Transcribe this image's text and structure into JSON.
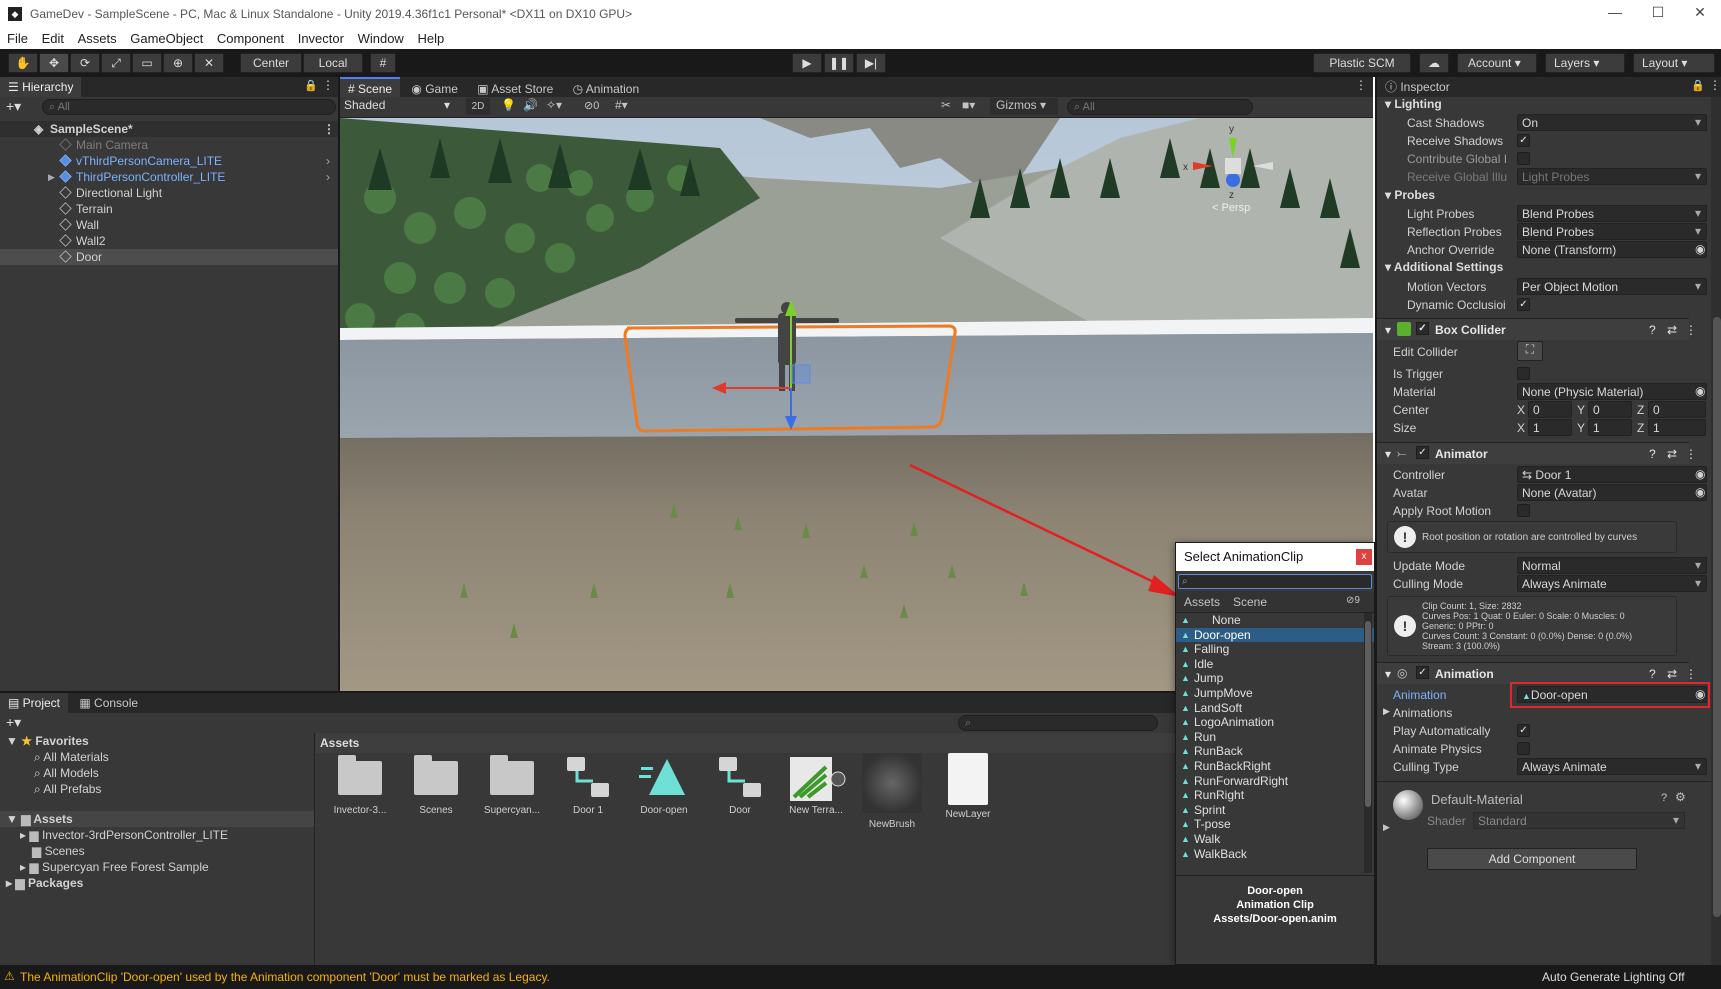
{
  "window": {
    "title": "GameDev - SampleScene - PC, Mac & Linux Standalone - Unity 2019.4.36f1c1 Personal* <DX11 on DX10 GPU>",
    "minimize": "—",
    "maximize": "☐",
    "close": "✕"
  },
  "menu": [
    "File",
    "Edit",
    "Assets",
    "GameObject",
    "Component",
    "Invector",
    "Window",
    "Help"
  ],
  "toolbar": {
    "pivot": "Center",
    "space": "Local",
    "plastic": "Plastic SCM",
    "account": "Account",
    "layers": "Layers",
    "layout": "Layout"
  },
  "hierarchy": {
    "tab": "Hierarchy",
    "search_placeholder": "All",
    "scene": "SampleScene*",
    "items": [
      {
        "label": "Main Camera",
        "style": "dim"
      },
      {
        "label": "vThirdPersonCamera_LITE",
        "style": "prefab"
      },
      {
        "label": "ThirdPersonController_LITE",
        "style": "prefab"
      },
      {
        "label": "Directional Light",
        "style": "normal"
      },
      {
        "label": "Terrain",
        "style": "normal"
      },
      {
        "label": "Wall",
        "style": "normal"
      },
      {
        "label": "Wall2",
        "style": "normal"
      },
      {
        "label": "Door",
        "style": "selected"
      }
    ]
  },
  "scene_tabs": [
    "Scene",
    "Game",
    "Asset Store",
    "Animation"
  ],
  "scene_toolbar": {
    "shading": "Shaded",
    "mode2d": "2D",
    "hidden_count": "0",
    "gizmos": "Gizmos",
    "search_placeholder": "All",
    "persp": "< Persp"
  },
  "project": {
    "tabs": [
      "Project",
      "Console"
    ],
    "favorites_label": "Favorites",
    "favorites": [
      "All Materials",
      "All Models",
      "All Prefabs"
    ],
    "assets_label": "Assets",
    "asset_tree": [
      "Invector-3rdPersonController_LITE",
      "Scenes",
      "Supercyan Free Forest Sample"
    ],
    "packages_label": "Packages",
    "breadcrumb": "Assets",
    "grid": [
      {
        "label": "Invector-3...",
        "kind": "folder"
      },
      {
        "label": "Scenes",
        "kind": "folder"
      },
      {
        "label": "Supercyan...",
        "kind": "folder"
      },
      {
        "label": "Door 1",
        "kind": "controller"
      },
      {
        "label": "Door-open",
        "kind": "clip"
      },
      {
        "label": "Door",
        "kind": "controller"
      },
      {
        "label": "New Terra...",
        "kind": "terrain"
      },
      {
        "label": "NewBrush",
        "kind": "brush"
      },
      {
        "label": "NewLayer",
        "kind": "file"
      }
    ]
  },
  "picker": {
    "title": "Select AnimationClip",
    "tabs": [
      "Assets",
      "Scene"
    ],
    "hidden_count": "9",
    "none": "None",
    "items": [
      "Door-open",
      "Falling",
      "Idle",
      "Jump",
      "JumpMove",
      "LandSoft",
      "LogoAnimation",
      "Run",
      "RunBack",
      "RunBackRight",
      "RunForwardRight",
      "RunRight",
      "Sprint",
      "T-pose",
      "Walk",
      "WalkBack"
    ],
    "selected": "Door-open",
    "footer": [
      "Door-open",
      "Animation Clip",
      "Assets/Door-open.anim"
    ]
  },
  "inspector": {
    "tab": "Inspector",
    "lighting": {
      "header": "Lighting",
      "rows": [
        {
          "label": "Cast Shadows",
          "type": "dropdown",
          "value": "On"
        },
        {
          "label": "Receive Shadows",
          "type": "check",
          "value": "✓"
        },
        {
          "label": "Contribute Global I",
          "type": "check",
          "value": ""
        },
        {
          "label": "Receive Global Illu",
          "type": "dropdown",
          "value": "Light Probes",
          "dim": true
        }
      ]
    },
    "probes": {
      "header": "Probes",
      "rows": [
        {
          "label": "Light Probes",
          "type": "dropdown",
          "value": "Blend Probes"
        },
        {
          "label": "Reflection Probes",
          "type": "dropdown",
          "value": "Blend Probes"
        },
        {
          "label": "Anchor Override",
          "type": "object",
          "value": "None (Transform)"
        }
      ]
    },
    "additional": {
      "header": "Additional Settings",
      "rows": [
        {
          "label": "Motion Vectors",
          "type": "dropdown",
          "value": "Per Object Motion"
        },
        {
          "label": "Dynamic Occlusioi",
          "type": "check",
          "value": "✓"
        }
      ]
    },
    "box_collider": {
      "header": "Box Collider",
      "edit": "Edit Collider",
      "is_trigger": "Is Trigger",
      "material_label": "Material",
      "material": "None (Physic Material)",
      "center_label": "Center",
      "center": {
        "x": "0",
        "y": "0",
        "z": "0"
      },
      "size_label": "Size",
      "size": {
        "x": "1",
        "y": "1",
        "z": "1"
      }
    },
    "animator": {
      "header": "Animator",
      "controller_label": "Controller",
      "controller": "Door 1",
      "avatar_label": "Avatar",
      "avatar": "None (Avatar)",
      "apply_root_label": "Apply Root Motion",
      "info": "Root position or rotation are controlled by curves",
      "update_label": "Update Mode",
      "update": "Normal",
      "culling_label": "Culling Mode",
      "culling": "Always Animate",
      "stats": [
        "Clip Count: 1, Size: 2832",
        "Curves Pos: 1 Quat: 0 Euler: 0 Scale: 0 Muscles: 0",
        "Generic: 0 PPtr: 0",
        "Curves Count: 3 Constant: 0 (0.0%) Dense: 0 (0.0%)",
        "Stream: 3 (100.0%)"
      ]
    },
    "animation": {
      "header": "Animation",
      "animation_label": "Animation",
      "animation_value": "Door-open",
      "animations_label": "Animations",
      "play_label": "Play Automatically",
      "physics_label": "Animate Physics",
      "culling_label": "Culling Type",
      "culling": "Always Animate"
    },
    "material": {
      "name": "Default-Material",
      "shader_label": "Shader",
      "shader": "Standard"
    },
    "add_component": "Add Component"
  },
  "status": {
    "warning": "The AnimationClip 'Door-open' used by the Animation component 'Door' must be marked as Legacy.",
    "right": "Auto Generate Lighting Off"
  },
  "colors": {
    "accent": "#4c7eff",
    "highlight_box": "#e3262b",
    "arrow": "#e32020",
    "selection": "#2c5d87",
    "prefab_text": "#7cb2ff"
  }
}
